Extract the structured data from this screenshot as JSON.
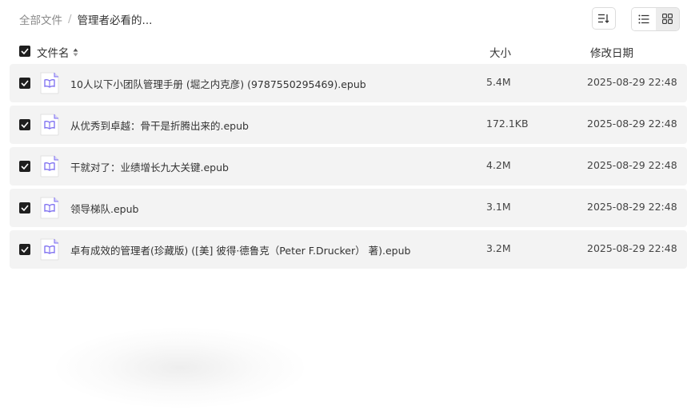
{
  "breadcrumb": {
    "root": "全部文件",
    "separator": "/",
    "current": "管理者必看的..."
  },
  "toolbar": {
    "sort_icon": "sort-icon",
    "list_view_icon": "list-view-icon",
    "grid_view_icon": "grid-view-icon",
    "active_view": "list"
  },
  "columns": {
    "name": "文件名",
    "size": "大小",
    "modified": "修改日期"
  },
  "select_all_checked": true,
  "files": [
    {
      "name": "10人以下小团队管理手册 (堀之内克彦) (9787550295469).epub",
      "size": "5.4M",
      "modified": "2025-08-29 22:48",
      "checked": true,
      "icon": "epub-book-icon"
    },
    {
      "name": "从优秀到卓越：骨干是折腾出来的.epub",
      "size": "172.1KB",
      "modified": "2025-08-29 22:48",
      "checked": true,
      "icon": "epub-book-icon"
    },
    {
      "name": "干就对了：业绩增长九大关键.epub",
      "size": "4.2M",
      "modified": "2025-08-29 22:48",
      "checked": true,
      "icon": "epub-book-icon"
    },
    {
      "name": "领导梯队.epub",
      "size": "3.1M",
      "modified": "2025-08-29 22:48",
      "checked": true,
      "icon": "epub-book-icon"
    },
    {
      "name": "卓有成效的管理者(珍藏版) ([美] 彼得·德鲁克（Peter F.Drucker） 著).epub",
      "size": "3.2M",
      "modified": "2025-08-29 22:48",
      "checked": true,
      "icon": "epub-book-icon"
    }
  ],
  "colors": {
    "row_background": "#f3f3f3",
    "checkbox": "#1f1f1f",
    "file_icon_accent": "#7b6cf0"
  }
}
